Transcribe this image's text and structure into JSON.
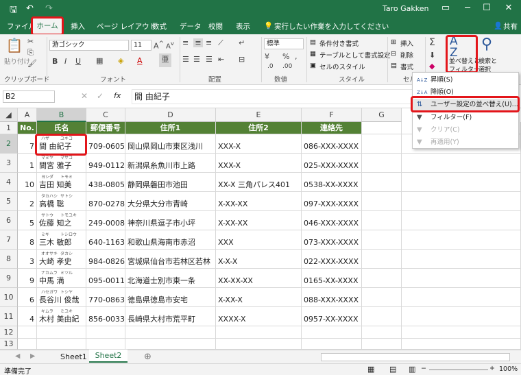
{
  "titlebar": {
    "user": "Taro Gakken",
    "minimize": "─",
    "restore": "☐",
    "close": "✕",
    "save": "🖫",
    "undo": "↶",
    "redo": "↷",
    "ribbon_display": "▭"
  },
  "tabs": {
    "file": "ファイル",
    "home": "ホーム",
    "insert": "挿入",
    "layout": "ページ レイアウト",
    "formulas": "数式",
    "data": "データ",
    "review": "校閲",
    "view": "表示",
    "tell": "実行したい作業を入力してください",
    "share": "共有"
  },
  "ribbon": {
    "paste": "貼り付け",
    "clipboard": "クリップボード",
    "font_name": "游ゴシック",
    "font_size": "11",
    "font_group": "フォント",
    "align_group": "配置",
    "number_format": "標準",
    "number_group": "数値",
    "cond_format": "条件付き書式",
    "table_format": "テーブルとして書式設定",
    "cell_style": "セルのスタイル",
    "style_group": "スタイル",
    "insert": "挿入",
    "delete": "削除",
    "format": "書式",
    "cells_group": "セル",
    "sort_filter_1": "並べ替えと",
    "sort_filter_2": "フィルター",
    "find_1": "検索と",
    "find_2": "選択"
  },
  "formula_bar": {
    "namebox": "B2",
    "fx": "fx",
    "value": "間 由紀子"
  },
  "columns": [
    "A",
    "B",
    "C",
    "D",
    "E",
    "F",
    "G"
  ],
  "header_row": [
    "No.",
    "氏名",
    "郵便番号",
    "住所1",
    "住所2",
    "連絡先"
  ],
  "rows": [
    {
      "no": "7",
      "ruby1": "ハザ",
      "ruby2": "ユキコ",
      "name": "間 由紀子",
      "zip": "709-0605",
      "addr1": "岡山県岡山市東区浅川",
      "addr2": "XXX-X",
      "tel": "086-XXX-XXXX"
    },
    {
      "no": "1",
      "ruby1": "マミヤ",
      "ruby2": "マサコ",
      "name": "間宮 雅子",
      "zip": "949-0112",
      "addr1": "新潟県糸魚川市上路",
      "addr2": "XXX-X",
      "tel": "025-XXX-XXXX"
    },
    {
      "no": "10",
      "ruby1": "ヨシダ",
      "ruby2": "トモミ",
      "name": "吉田 知美",
      "zip": "438-0805",
      "addr1": "静岡県磐田市池田",
      "addr2": "XX-X 三角パレス401",
      "tel": "0538-XX-XXXX"
    },
    {
      "no": "2",
      "ruby1": "タカハシ",
      "ruby2": "サトシ",
      "name": "高橋 聡",
      "zip": "870-0278",
      "addr1": "大分県大分市青崎",
      "addr2": "X-XX-XX",
      "tel": "097-XXX-XXXX"
    },
    {
      "no": "5",
      "ruby1": "サトウ",
      "ruby2": "トモユキ",
      "name": "佐藤 知之",
      "zip": "249-0008",
      "addr1": "神奈川県逗子市小坪",
      "addr2": "X-XX-XX",
      "tel": "046-XXX-XXXX"
    },
    {
      "no": "8",
      "ruby1": "ミキ",
      "ruby2": "トシロウ",
      "name": "三木 敏郎",
      "zip": "640-1163",
      "addr1": "和歌山県海南市赤沼",
      "addr2": "XXX",
      "tel": "073-XXX-XXXX"
    },
    {
      "no": "3",
      "ruby1": "オオサキ",
      "ruby2": "タカシ",
      "name": "大崎 孝史",
      "zip": "984-0826",
      "addr1": "宮城県仙台市若林区若林",
      "addr2": "X-X-X",
      "tel": "022-XXX-XXXX"
    },
    {
      "no": "9",
      "ruby1": "ナカムラ",
      "ruby2": "ミツル",
      "name": "中馬 満",
      "zip": "095-0011",
      "addr1": "北海道士別市東一条",
      "addr2": "XX-XX-XX",
      "tel": "0165-XX-XXXX"
    },
    {
      "no": "6",
      "ruby1": "ハセガワ",
      "ruby2": "トシヤ",
      "name": "長谷川 俊哉",
      "zip": "770-0863",
      "addr1": "徳島県徳島市安宅",
      "addr2": "X-XX-X",
      "tel": "088-XXX-XXXX"
    },
    {
      "no": "4",
      "ruby1": "キムラ",
      "ruby2": "ミユキ",
      "name": "木村 美由紀",
      "zip": "856-0033",
      "addr1": "長崎県大村市荒平町",
      "addr2": "XXXX-X",
      "tel": "0957-XX-XXXX"
    }
  ],
  "row_numbers": [
    "1",
    "2",
    "3",
    "4",
    "5",
    "6",
    "7",
    "8",
    "9",
    "10",
    "11",
    "12",
    "13"
  ],
  "menu": [
    {
      "label": "昇順(S)",
      "icon": "A↓Z"
    },
    {
      "label": "降順(O)",
      "icon": "Z↓A"
    },
    {
      "label": "ユーザー設定の並べ替え(U)...",
      "icon": "⇅"
    },
    {
      "label": "フィルター(F)",
      "icon": "▼"
    },
    {
      "label": "クリア(C)",
      "icon": "▼"
    },
    {
      "label": "再適用(Y)",
      "icon": "▼"
    }
  ],
  "sheets": {
    "sheet1": "Sheet1",
    "sheet2": "Sheet2",
    "add": "⊕"
  },
  "status": {
    "ready": "準備完了",
    "zoom": "100%"
  },
  "colors": {
    "excel_green": "#217346",
    "header_fill": "#538135",
    "highlight": "#e3151a"
  }
}
